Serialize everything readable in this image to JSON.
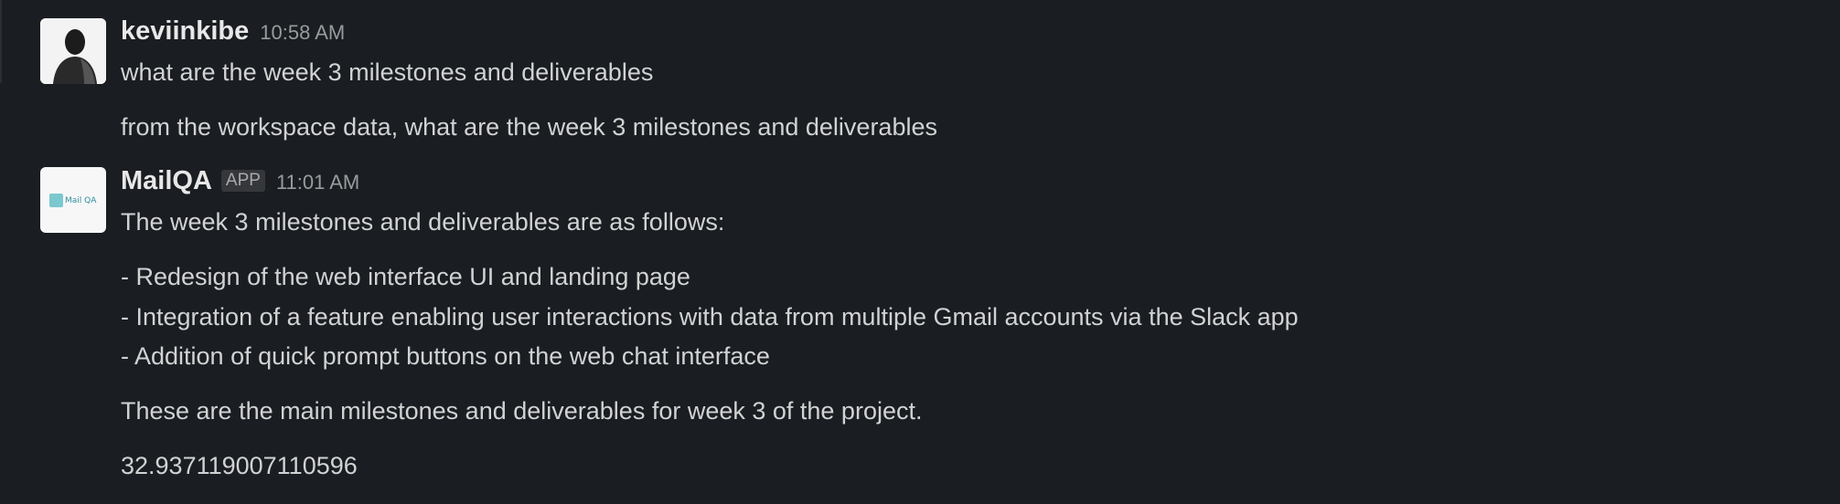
{
  "messages": [
    {
      "sender": "keviinkibe",
      "timestamp": "10:58 AM",
      "avatar_icon": "user-photo-avatar",
      "lines": [
        "what are the week 3 milestones and deliverables",
        "from the workspace data, what are the week 3 milestones and deliverables"
      ]
    },
    {
      "sender": "MailQA",
      "badge": "APP",
      "timestamp": "11:01 AM",
      "avatar_icon": "mailqa-logo",
      "avatar_label": "Mail QA",
      "lines": [
        "The week 3 milestones and deliverables are as follows:",
        "- Redesign of the web interface UI and landing page",
        "- Integration of a feature enabling user interactions with data from multiple Gmail accounts via the Slack app",
        "- Addition of quick prompt buttons on the web chat interface",
        "These are the main milestones and deliverables for week 3 of the project.",
        "32.937119007110596"
      ]
    }
  ],
  "colors": {
    "background": "#1a1d21",
    "text": "#d1d2d3",
    "sender": "#e8e8e8",
    "timestamp": "#9a9b9d",
    "badge_bg": "#35373b"
  }
}
